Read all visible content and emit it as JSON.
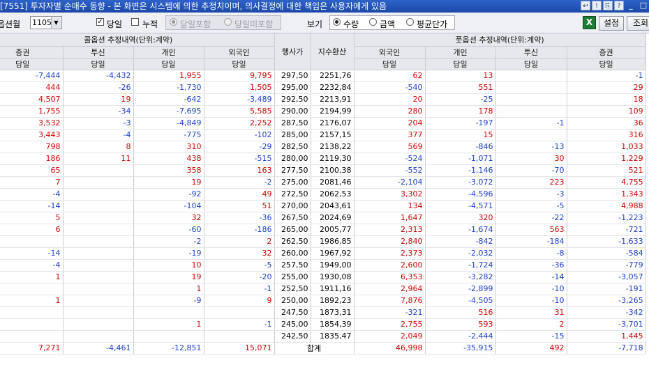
{
  "window": {
    "title": "[7551] 투자자별 순매수 동향 - 본 화면은 시스템에 의한 추정치이며, 의사결정에 대한 책임은 사용자에게 있음",
    "buttons": [
      "↩",
      "!",
      "⎘",
      "?",
      "_",
      "□"
    ]
  },
  "toolbar": {
    "option_month_label": "옵션월",
    "option_month_value": "1105",
    "today_label": "당일",
    "today_checked": true,
    "cumulative_label": "누적",
    "cumulative_checked": false,
    "include_today_label": "당일포함",
    "exclude_today_label": "당일미포함",
    "view_label": "보기",
    "view_options": [
      "수량",
      "금액",
      "평균단가"
    ],
    "view_selected": "수량",
    "excel_icon": "X",
    "settings_label": "설정",
    "query_label": "조회"
  },
  "table": {
    "call_group": "콜옵션 추정내역(단위:계약)",
    "put_group": "풋옵션 추정내역(단위:계약)",
    "strike_header": "행사가",
    "index_header": "지수환산",
    "call_columns": [
      "증권",
      "투신",
      "개인",
      "외국인"
    ],
    "put_columns": [
      "외국인",
      "개인",
      "투신",
      "증권"
    ],
    "sub_label": "당일",
    "rows": [
      {
        "call": [
          "-7,444",
          "-4,432",
          "1,955",
          "9,795"
        ],
        "strike": "297,50",
        "index": "2251,76",
        "put": [
          "62",
          "13",
          "",
          "-1"
        ]
      },
      {
        "call": [
          "444",
          "-26",
          "-1,730",
          "1,505"
        ],
        "strike": "295,00",
        "index": "2232,84",
        "put": [
          "-540",
          "551",
          "",
          "29"
        ]
      },
      {
        "call": [
          "4,507",
          "19",
          "-642",
          "-3,489"
        ],
        "strike": "292,50",
        "index": "2213,91",
        "put": [
          "20",
          "-25",
          "",
          "18"
        ]
      },
      {
        "call": [
          "1,755",
          "-34",
          "-7,695",
          "5,585"
        ],
        "strike": "290,00",
        "index": "2194,99",
        "put": [
          "280",
          "178",
          "",
          "109"
        ]
      },
      {
        "call": [
          "3,532",
          "-3",
          "-4,849",
          "2,252"
        ],
        "strike": "287,50",
        "index": "2176,07",
        "put": [
          "204",
          "-197",
          "-1",
          "36"
        ]
      },
      {
        "call": [
          "3,443",
          "-4",
          "-775",
          "-102"
        ],
        "strike": "285,00",
        "index": "2157,15",
        "put": [
          "377",
          "15",
          "",
          "316"
        ]
      },
      {
        "call": [
          "798",
          "8",
          "310",
          "-29"
        ],
        "strike": "282,50",
        "index": "2138,22",
        "put": [
          "569",
          "-846",
          "-13",
          "1,033"
        ]
      },
      {
        "call": [
          "186",
          "11",
          "438",
          "-515"
        ],
        "strike": "280,00",
        "index": "2119,30",
        "put": [
          "-524",
          "-1,071",
          "30",
          "1,229"
        ]
      },
      {
        "call": [
          "65",
          "",
          "358",
          "163"
        ],
        "strike": "277,50",
        "index": "2100,38",
        "put": [
          "-552",
          "-1,146",
          "-70",
          "521"
        ]
      },
      {
        "call": [
          "7",
          "",
          "19",
          "-2"
        ],
        "strike": "275,00",
        "index": "2081,46",
        "put": [
          "-2,104",
          "-3,072",
          "223",
          "4,755"
        ]
      },
      {
        "call": [
          "-4",
          "",
          "-92",
          "49"
        ],
        "strike": "272,50",
        "index": "2062,53",
        "put": [
          "3,302",
          "-4,596",
          "-3",
          "1,343"
        ]
      },
      {
        "call": [
          "-14",
          "",
          "-104",
          "51"
        ],
        "strike": "270,00",
        "index": "2043,61",
        "put": [
          "134",
          "-4,571",
          "-5",
          "4,988"
        ]
      },
      {
        "call": [
          "5",
          "",
          "32",
          "-36"
        ],
        "strike": "267,50",
        "index": "2024,69",
        "put": [
          "1,647",
          "320",
          "-22",
          "-1,223"
        ]
      },
      {
        "call": [
          "6",
          "",
          "-60",
          "-186"
        ],
        "strike": "265,00",
        "index": "2005,77",
        "put": [
          "2,313",
          "-1,674",
          "563",
          "-721"
        ]
      },
      {
        "call": [
          "",
          "",
          "-2",
          "2"
        ],
        "strike": "262,50",
        "index": "1986,85",
        "put": [
          "2,840",
          "-842",
          "-184",
          "-1,633"
        ]
      },
      {
        "call": [
          "-14",
          "",
          "-19",
          "32"
        ],
        "strike": "260,00",
        "index": "1967,92",
        "put": [
          "2,373",
          "-2,032",
          "-8",
          "-584"
        ]
      },
      {
        "call": [
          "-4",
          "",
          "10",
          "-5"
        ],
        "strike": "257,50",
        "index": "1949,00",
        "put": [
          "2,600",
          "-1,724",
          "-36",
          "-779"
        ]
      },
      {
        "call": [
          "1",
          "",
          "19",
          "-20"
        ],
        "strike": "255,00",
        "index": "1930,08",
        "put": [
          "6,353",
          "-3,282",
          "-14",
          "-3,057"
        ]
      },
      {
        "call": [
          "",
          "",
          "1",
          "-1"
        ],
        "strike": "252,50",
        "index": "1911,16",
        "put": [
          "2,964",
          "-2,899",
          "-10",
          "-191"
        ]
      },
      {
        "call": [
          "1",
          "",
          "-9",
          "9"
        ],
        "strike": "250,00",
        "index": "1892,23",
        "put": [
          "7,876",
          "-4,505",
          "-10",
          "-3,265"
        ]
      },
      {
        "call": [
          "",
          "",
          "",
          ""
        ],
        "strike": "247,50",
        "index": "1873,31",
        "put": [
          "-321",
          "516",
          "31",
          "-342"
        ]
      },
      {
        "call": [
          "",
          "",
          "1",
          "-1"
        ],
        "strike": "245,00",
        "index": "1854,39",
        "put": [
          "2,755",
          "593",
          "2",
          "-3,701"
        ]
      },
      {
        "call": [
          "",
          "",
          "",
          ""
        ],
        "strike": "242,50",
        "index": "1835,47",
        "put": [
          "2,049",
          "-2,444",
          "-15",
          "1,445"
        ]
      }
    ],
    "total": {
      "call": [
        "7,271",
        "-4,461",
        "-12,851",
        "15,071"
      ],
      "label": "합계",
      "put": [
        "46,998",
        "-35,915",
        "492",
        "-7,718"
      ]
    }
  }
}
